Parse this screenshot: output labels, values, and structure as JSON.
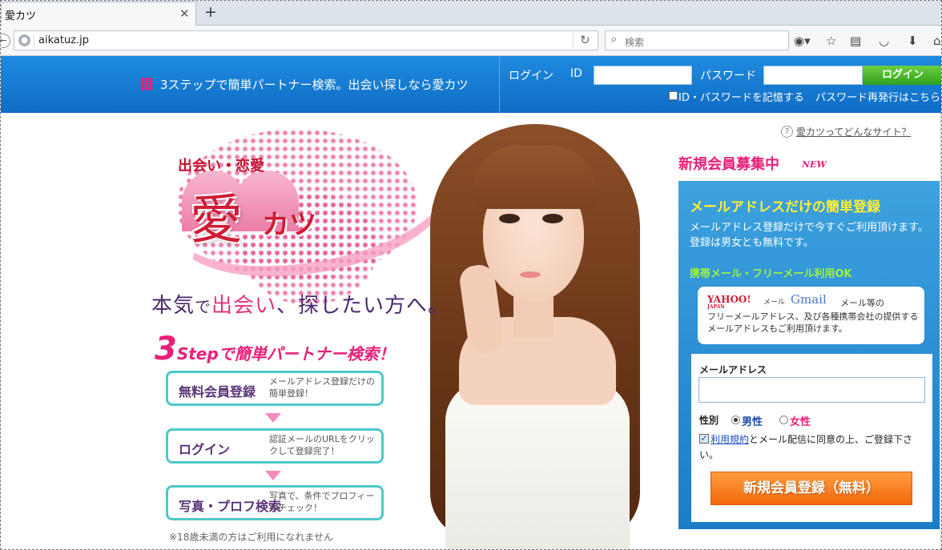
{
  "browser": {
    "tab_title": "愛カツ",
    "tab_close": "✕",
    "new_tab": "+",
    "url": "aikatuz.jp",
    "search_placeholder": "検索",
    "icons": [
      "globe-icon",
      "reload-icon",
      "search-icon",
      "profile-icon",
      "bookmark-star-icon",
      "reading-list-icon",
      "pocket-icon",
      "download-icon",
      "home-icon"
    ]
  },
  "header": {
    "tagline": "3ステップで簡単パートナー検索。出会い探しなら愛カツ",
    "login_label": "ログイン",
    "id_label": "ID",
    "id_value": "",
    "password_label": "パスワード",
    "password_value": "",
    "login_button": "ログイン",
    "remember_label": "ID・パスワードを記憶する",
    "reissue_link": "パスワード再発行はこちら",
    "colors": {
      "header_blue": "#1a7fd6",
      "login_green": "#3fae2a"
    }
  },
  "hero": {
    "logo_sub": "出会い・恋愛",
    "logo_kanji": "愛",
    "logo_kana": "カツ",
    "headline_1": "本気",
    "headline_2": "で",
    "headline_3": "出会い",
    "headline_4": "、探したい方へ。",
    "step_num": "3",
    "step_rest": "Stepで簡単パートナー検索！",
    "steps": [
      {
        "title": "無料会員登録",
        "desc": "メールアドレス登録だけの簡単登録！"
      },
      {
        "title": "ログイン",
        "desc": "認証メールのURLをクリックして登録完了！"
      },
      {
        "title": "写真・プロフ検索",
        "desc": "写真で、条件でプロフィールチェック！"
      }
    ],
    "age_note": "※18歳未満の方はご利用になれません"
  },
  "registration": {
    "about_icon": "?",
    "about_link": "愛カツってどんなサイト？",
    "recruit_title": "新規会員募集中",
    "new_mark": "NEW",
    "panel_title": "メールアドレスだけの簡単登録",
    "panel_desc": "メールアドレス登録だけで今すぐご利用頂けます。登録は男女とも無料です。",
    "mobile_ok": "携帯メール・フリーメール利用OK",
    "yahoo_logo": "YAHOO!",
    "yahoo_sub": "JAPAN",
    "mail_word": "メール",
    "gmail_logo": "Gmail",
    "mail_etc": "メール等の",
    "mail_note": "フリーメールアドレス、及び各種携帯会社の提供するメールアドレスもご利用頂けます。",
    "email_label": "メールアドレス",
    "email_value": "",
    "gender_label": "性別",
    "male_label": "男性",
    "female_label": "女性",
    "selected_gender": "男性",
    "terms_link": "利用規約",
    "agree_rest": "とメール配信に同意の上、ご登録下さい。",
    "agree_checked": true,
    "submit_button": "新規会員登録（無料）",
    "colors": {
      "panel_blue": "#2a8fd4",
      "submit_orange": "#f57d1f",
      "pink": "#e8207a",
      "yellow": "#ffee33",
      "green": "#9df53b"
    }
  }
}
